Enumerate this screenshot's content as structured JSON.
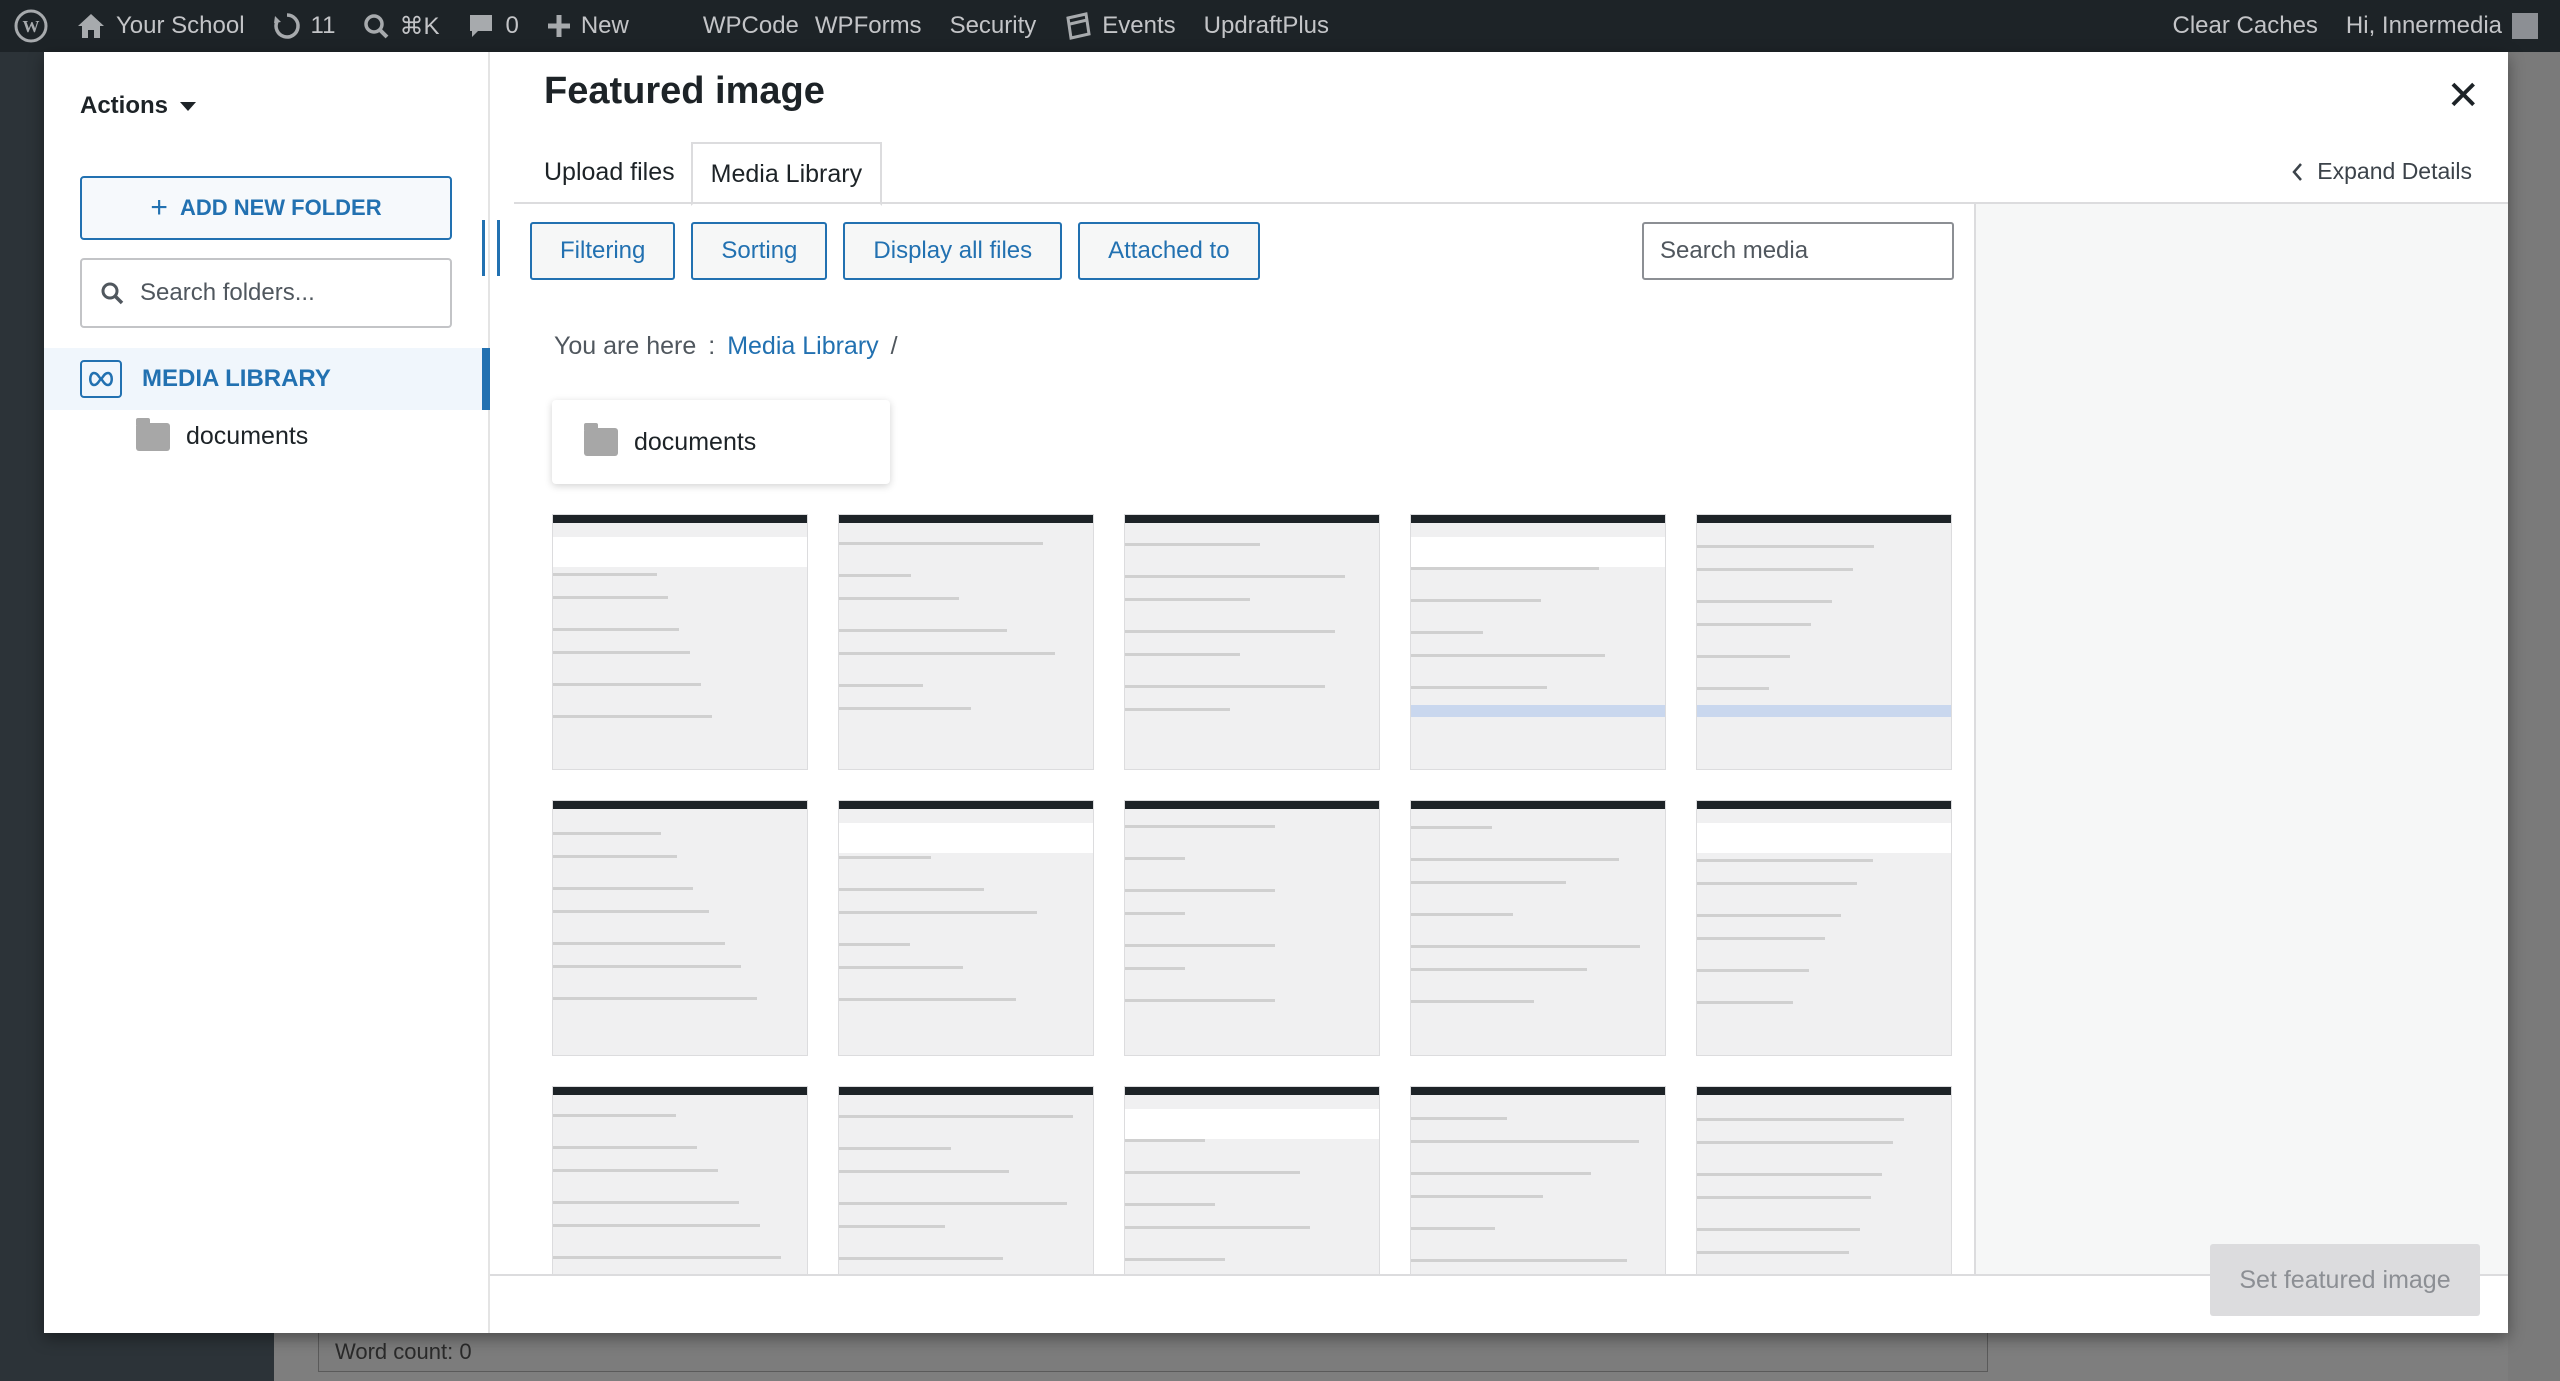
{
  "adminbar": {
    "site_name": "Your School",
    "updates_count": "11",
    "shortcut": "⌘K",
    "comments_count": "0",
    "new_label": "New",
    "menu": [
      "WPCode",
      "WPForms",
      "Security",
      "Events",
      "UpdraftPlus"
    ],
    "clear_caches": "Clear Caches",
    "greeting": "Hi, Innermedia"
  },
  "background": {
    "word_count": "Word count: 0"
  },
  "folders": {
    "actions_label": "Actions",
    "add_folder_label": "ADD NEW FOLDER",
    "search_placeholder": "Search folders...",
    "root_label": "MEDIA LIBRARY",
    "children": [
      "documents"
    ]
  },
  "modal": {
    "title": "Featured image",
    "tabs": [
      "Upload files",
      "Media Library"
    ],
    "active_tab": "Media Library",
    "expand_details": "Expand Details",
    "toolbar": [
      "Filtering",
      "Sorting",
      "Display all files",
      "Attached to"
    ],
    "search_placeholder": "Search media",
    "breadcrumb": {
      "prefix": "You are here",
      "separator": ":",
      "current": "Media Library",
      "trail": "/"
    },
    "folder_card": "documents",
    "thumbnail_count": 15,
    "set_button": "Set featured image"
  },
  "colors": {
    "accent": "#2271b1",
    "adminbar_bg": "#1d2327",
    "disabled_button": "#dcdcde"
  },
  "icons": {
    "adminbar": [
      "wordpress-icon",
      "home-icon",
      "updates-icon",
      "search-icon",
      "comment-icon",
      "plus-icon",
      "events-icon",
      "avatar"
    ],
    "modal": [
      "close-icon",
      "chevron-left-icon",
      "folder-icon",
      "plus-icon",
      "search-icon",
      "media-library-icon"
    ]
  }
}
